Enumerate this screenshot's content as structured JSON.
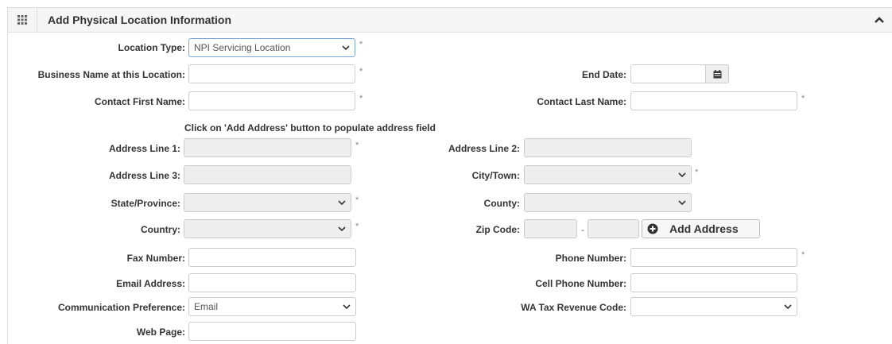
{
  "panel": {
    "title": "Add Physical Location Information",
    "icons": {
      "grid": "grid-icon",
      "collapse": "chevron-up-icon"
    }
  },
  "fields": {
    "location_type": {
      "label": "Location Type:",
      "value": "NPI Servicing Location",
      "required": "*"
    },
    "business_name": {
      "label": "Business Name at this Location:",
      "value": "",
      "required": "*"
    },
    "end_date": {
      "label": "End Date:",
      "value": ""
    },
    "contact_first_name": {
      "label": "Contact First Name:",
      "value": "",
      "required": "*"
    },
    "contact_last_name": {
      "label": "Contact Last Name:",
      "value": "",
      "required": "*"
    },
    "address_note": "Click on 'Add Address' button to populate address field",
    "address_line_1": {
      "label": "Address Line 1:",
      "value": "",
      "required": "*"
    },
    "address_line_2": {
      "label": "Address Line 2:",
      "value": ""
    },
    "address_line_3": {
      "label": "Address Line 3:",
      "value": ""
    },
    "city_town": {
      "label": "City/Town:",
      "value": "",
      "required": "*"
    },
    "state_province": {
      "label": "State/Province:",
      "value": "",
      "required": "*"
    },
    "county": {
      "label": "County:",
      "value": ""
    },
    "country": {
      "label": "Country:",
      "value": "",
      "required": "*"
    },
    "zip_code": {
      "label": "Zip Code:",
      "value": "",
      "ext": "",
      "separator": "-"
    },
    "add_address": {
      "label": "Add Address"
    },
    "fax_number": {
      "label": "Fax Number:",
      "value": ""
    },
    "phone_number": {
      "label": "Phone Number:",
      "value": "",
      "required": "*"
    },
    "email_address": {
      "label": "Email Address:",
      "value": ""
    },
    "cell_phone_number": {
      "label": "Cell Phone Number:",
      "value": ""
    },
    "communication_preference": {
      "label": "Communication Preference:",
      "value": "Email"
    },
    "wa_tax_revenue_code": {
      "label": "WA Tax Revenue Code:",
      "value": ""
    },
    "web_page": {
      "label": "Web Page:",
      "value": ""
    }
  }
}
